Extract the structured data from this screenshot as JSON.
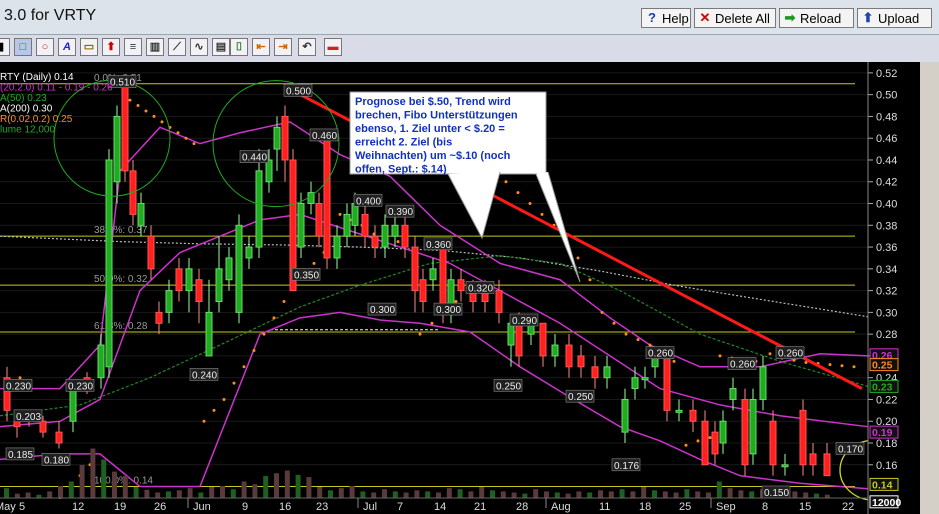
{
  "window": {
    "title": "3.0 for VRTY"
  },
  "buttons": {
    "help": "Help",
    "delete_all": "Delete All",
    "reload": "Reload",
    "upload": "Upload"
  },
  "legend": {
    "symbol": "RTY (Daily) 0.14",
    "bb": "(20,2.0) 0.11 - 0.19 - 0.26",
    "ma50": "A(50) 0.23",
    "ma200": "A(200) 0.30",
    "sar": "R(0.02,0.2) 0.25",
    "volume": "lume 12,000"
  },
  "annotation": "Prognose bei $.50, Trend wird brechen, Fibo Unterstützungen ebenso, 1. Ziel unter < $.20 = erreicht 2. Ziel (bis Weihnachten) um ~$.10 (noch offen, Sept.: $.14)",
  "fib_labels": [
    "38.2%: 0.37",
    "50.0%: 0.32",
    "61.8%: 0.28",
    "100.0%: 0.14",
    "0.0%: 0.51"
  ],
  "colors": {
    "bg": "#000000",
    "up": "#22aa22",
    "down": "#ff2020",
    "ma": "#cc33cc",
    "sar": "#ff8c1a",
    "fib": "#c8c820",
    "trend": "#ff1a1a"
  },
  "chart_data": {
    "type": "candlestick",
    "ylim": [
      0.135,
      0.53
    ],
    "y_ticks": [
      "0.52",
      "0.50",
      "0.48",
      "0.46",
      "0.44",
      "0.42",
      "0.40",
      "0.38",
      "0.36",
      "0.34",
      "0.32",
      "0.30",
      "0.28",
      "0.26",
      "0.24",
      "0.22",
      "0.20",
      "0.18",
      "0.16"
    ],
    "x_ticks": [
      "May",
      "5",
      "12",
      "19",
      "26",
      "Jun",
      "9",
      "16",
      "23",
      "Jul",
      "7",
      "14",
      "21",
      "28",
      "Aug",
      "11",
      "18",
      "25",
      "Sep",
      "8",
      "15",
      "22"
    ],
    "price_labels": [
      "0.510",
      "0.500",
      "0.460",
      "0.440",
      "0.400",
      "0.390",
      "0.360",
      "0.350",
      "0.320",
      "0.300",
      "0.300",
      "0.290",
      "0.260",
      "0.260",
      "0.250",
      "0.250",
      "0.240",
      "0.230",
      "0.230",
      "0.203",
      "0.185",
      "0.180",
      "0.176",
      "0.170",
      "0.150",
      "0.260"
    ],
    "right_labels": [
      {
        "text": "0.26",
        "color": "#cc33cc"
      },
      {
        "text": "0.25",
        "color": "#ff8c1a"
      },
      {
        "text": "0.23",
        "color": "#22aa22"
      },
      {
        "text": "0.19",
        "color": "#cc33cc"
      },
      {
        "text": "0.14",
        "color": "#c8c820"
      },
      {
        "text": "12000",
        "color": "#ffffff"
      }
    ]
  }
}
